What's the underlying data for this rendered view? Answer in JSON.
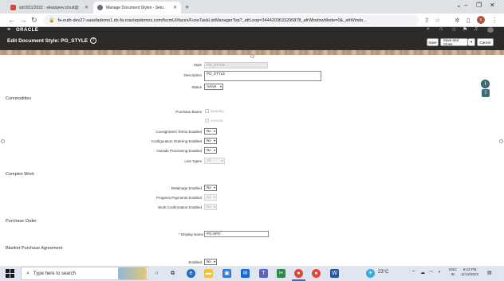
{
  "browser": {
    "tabs": [
      {
        "label": "std 8/11/2022 - sksanjeev.cloud@",
        "favicon": "gmail-icon",
        "color": "#d44638"
      },
      {
        "label": "Manage Document Styles - Setu",
        "favicon": "oracle-tab-icon",
        "color": "#6d6d6d"
      }
    ],
    "new_tab": "+",
    "url": "fa-euth-dev27-saasfademo1.ds-fa.oraclepdemos.com/fscmUI/faces/FuseTaskListManagerTop?_afrLoop=3444203633296878_afrWindowMode=0&_afrWindo...",
    "profile_initial": "s"
  },
  "app": {
    "logo": "ORACLE",
    "page_title": "Edit Document Style: PG_STYLE",
    "help": "?",
    "buttons": {
      "save": "Save",
      "save_and_close": "Save and Close",
      "cancel": "Cancel"
    }
  },
  "form": {
    "style_label": "Style",
    "style_value": "PG_STYLE",
    "description_label": "Description",
    "description_value": "PG_STYLE",
    "status_label": "Status",
    "status_value": "Active",
    "commodities_heading": "Commodities",
    "purchase_bases_label": "Purchase Bases",
    "quantity_label": "Quantity",
    "amount_label": "Amount",
    "consignment_label": "Consignment Terms Enabled",
    "consignment_value": "No",
    "config_ordering_label": "Configuration Ordering Enabled",
    "config_ordering_value": "No",
    "outside_processing_label": "Outside Processing Enabled",
    "outside_processing_value": "No",
    "line_types_label": "Line Types",
    "line_types_value": "All",
    "complex_work_heading": "Complex Work",
    "retainage_label": "Retainage Enabled",
    "retainage_value": "No",
    "progress_payments_label": "Progress Payments Enabled",
    "progress_payments_value": "No",
    "work_confirmation_label": "Work Confirmation Enabled",
    "work_confirmation_value": "No",
    "purchase_order_heading": "Purchase Order",
    "display_name_label": "Display Name",
    "display_name_required": "*",
    "display_name_value": "PG-SPO",
    "blanket_heading": "Blanket Purchase Agreement",
    "enabled_label": "Enabled",
    "enabled_value": "No"
  },
  "taskbar": {
    "search_placeholder": "Type here to search",
    "weather": "23°C",
    "lang_line1": "ENG",
    "lang_line2": "IN",
    "time": "9:23 PM",
    "date": "11/12/2022"
  }
}
